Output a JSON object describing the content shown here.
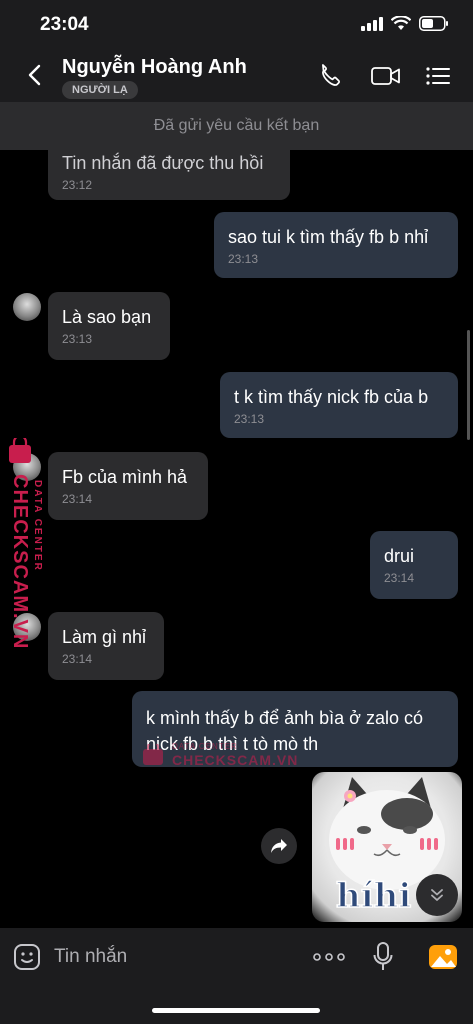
{
  "status_bar": {
    "time": "23:04"
  },
  "header": {
    "contact_name": "Nguyễn Hoàng Anh",
    "badge": "NGƯỜI LẠ"
  },
  "banner": {
    "text": "Đã gửi yêu cầu kết bạn"
  },
  "messages": [
    {
      "direction": "in",
      "text": "Tin nhắn đã được thu hồi",
      "time": "23:12"
    },
    {
      "direction": "out",
      "text": "sao tui k tìm thấy fb b nhỉ",
      "time": "23:13"
    },
    {
      "direction": "in",
      "text": "Là sao bạn",
      "time": "23:13"
    },
    {
      "direction": "out",
      "text": "t k tìm thấy nick fb của b",
      "time": "23:13"
    },
    {
      "direction": "in",
      "text": "Fb của mình hả",
      "time": "23:14"
    },
    {
      "direction": "out",
      "text": "drui",
      "time": "23:14"
    },
    {
      "direction": "in",
      "text": "Làm gì nhỉ",
      "time": "23:14"
    },
    {
      "direction": "out",
      "text": "k mình thấy b để ảnh bìa ở zalo có nick fb b thì t tò mò th",
      "time": ""
    }
  ],
  "sticker": {
    "caption": "híhi"
  },
  "watermark": {
    "vertical_small": "DATA CENTER",
    "vertical_big": "CHECKSCAM.VN",
    "horizontal_small": "DATA CENTER",
    "horizontal_big": "CHECKSCAM.VN"
  },
  "input_bar": {
    "placeholder": "Tin nhắn"
  },
  "colors": {
    "background": "#000000",
    "bar": "#1c1c1e",
    "incoming_bubble": "#2c2c2e",
    "outgoing_bubble": "#2d3644",
    "watermark": "#c81e4d",
    "gallery_accent": "#ff9f0a"
  }
}
